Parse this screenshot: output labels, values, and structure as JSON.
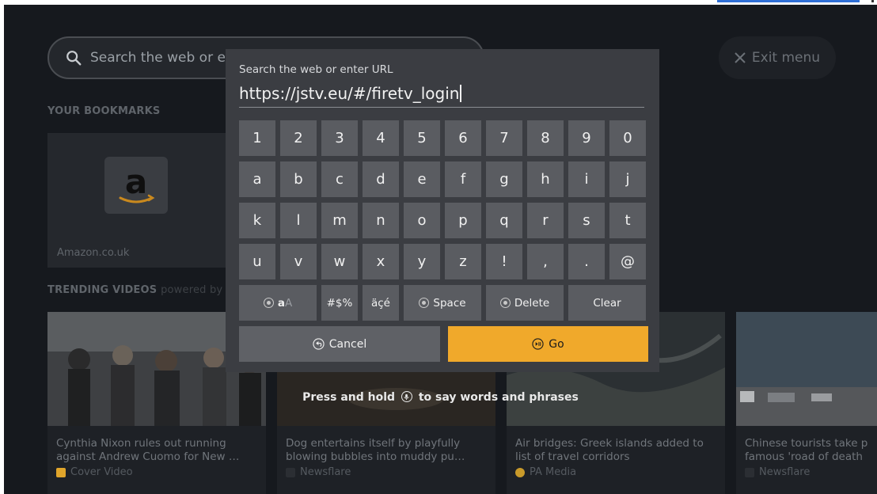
{
  "background": {
    "search_placeholder": "Search the web or en",
    "exit_menu_label": "Exit menu",
    "bookmarks_label": "YOUR BOOKMARKS",
    "bookmark": {
      "name": "Amazon.co.uk",
      "logo_letter": "a"
    },
    "trending_label": "TRENDING VIDEOS",
    "trending_sub": "powered by",
    "videos": [
      {
        "title": "Cynthia Nixon rules out running against Andrew Cuomo for New …",
        "source": "Cover Video",
        "source_color": "#e0a52b"
      },
      {
        "title": "Dog entertains itself by playfully blowing bubbles into muddy pu…",
        "source": "Newsflare",
        "source_color": "#2b2e33"
      },
      {
        "title": "Air bridges: Greek islands added to list of travel corridors",
        "source": "PA Media",
        "source_color": "#c99a2a"
      },
      {
        "title": "Chinese tourists take p famous 'road of death",
        "source": "Newsflare",
        "source_color": "#2b2e33"
      }
    ]
  },
  "keyboard": {
    "label": "Search the web or enter URL",
    "value": "https://jstv.eu/#/firetv_login",
    "rows": [
      [
        "1",
        "2",
        "3",
        "4",
        "5",
        "6",
        "7",
        "8",
        "9",
        "0"
      ],
      [
        "a",
        "b",
        "c",
        "d",
        "e",
        "f",
        "g",
        "h",
        "i",
        "j"
      ],
      [
        "k",
        "l",
        "m",
        "n",
        "o",
        "p",
        "q",
        "r",
        "s",
        "t"
      ],
      [
        "u",
        "v",
        "w",
        "x",
        "y",
        "z",
        "!",
        ",",
        ".",
        "@"
      ]
    ],
    "function_keys": {
      "case_main": "a",
      "case_sub": "A",
      "symbols": "#$%",
      "accents": "äçé",
      "space": "Space",
      "delete": "Delete",
      "clear": "Clear"
    },
    "cancel_label": "Cancel",
    "go_label": "Go"
  },
  "voice_hint": {
    "before": "Press and hold",
    "after": "to say words and phrases"
  },
  "colors": {
    "accent": "#f0a92b",
    "key": "#5a5c61",
    "dialog": "#3b3d42",
    "background": "#16191e"
  }
}
